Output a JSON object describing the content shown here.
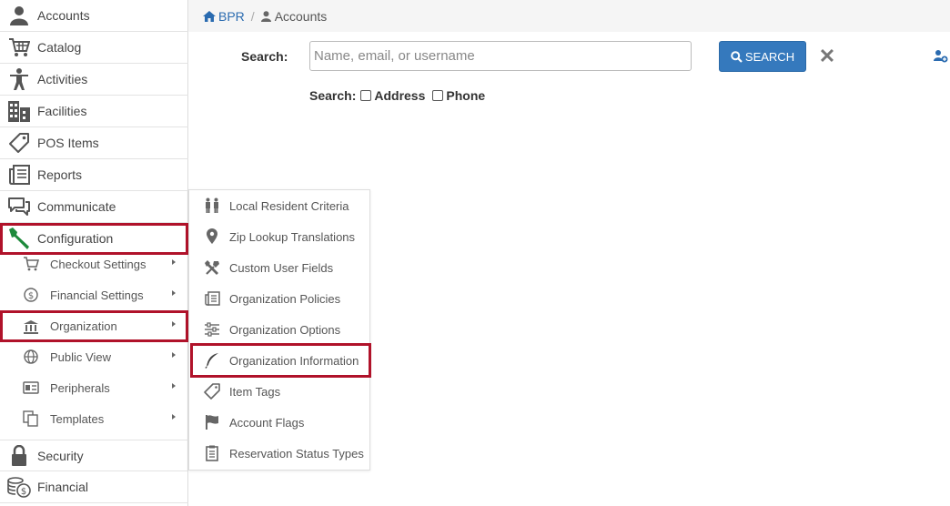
{
  "breadcrumb": {
    "home_label": "BPR",
    "separator": "/",
    "current_label": "Accounts"
  },
  "search": {
    "label": "Search:",
    "placeholder": "Name, email, or username",
    "value": "",
    "button_label": "SEARCH",
    "clear_icon": "close-icon",
    "add_icon": "add-user-icon",
    "options_label": "Search:",
    "options": [
      {
        "label": "Address",
        "checked": false
      },
      {
        "label": "Phone",
        "checked": false
      }
    ]
  },
  "sidebar": {
    "items": [
      {
        "label": "Accounts",
        "icon": "user-icon"
      },
      {
        "label": "Catalog",
        "icon": "cart-icon"
      },
      {
        "label": "Activities",
        "icon": "person-icon"
      },
      {
        "label": "Facilities",
        "icon": "building-icon"
      },
      {
        "label": "POS Items",
        "icon": "tag-icon"
      },
      {
        "label": "Reports",
        "icon": "reports-icon"
      },
      {
        "label": "Communicate",
        "icon": "chat-icon"
      },
      {
        "label": "Configuration",
        "icon": "wrench-icon"
      },
      {
        "label": "Security",
        "icon": "lock-icon"
      },
      {
        "label": "Financial",
        "icon": "money-icon"
      }
    ],
    "config_sub": [
      {
        "label": "Checkout Settings",
        "icon": "cart-icon"
      },
      {
        "label": "Financial Settings",
        "icon": "dollar-icon"
      },
      {
        "label": "Organization",
        "icon": "bank-icon"
      },
      {
        "label": "Public View",
        "icon": "globe-icon"
      },
      {
        "label": "Peripherals",
        "icon": "id-card-icon"
      },
      {
        "label": "Templates",
        "icon": "copy-icon"
      }
    ]
  },
  "flyout": {
    "items": [
      {
        "label": "Local Resident Criteria",
        "icon": "people-icon"
      },
      {
        "label": "Zip Lookup Translations",
        "icon": "map-pin-icon"
      },
      {
        "label": "Custom User Fields",
        "icon": "tools-icon"
      },
      {
        "label": "Organization Policies",
        "icon": "policies-icon"
      },
      {
        "label": "Organization Options",
        "icon": "sliders-icon"
      },
      {
        "label": "Organization Information",
        "icon": "feather-icon"
      },
      {
        "label": "Item Tags",
        "icon": "tag-icon"
      },
      {
        "label": "Account Flags",
        "icon": "flag-icon"
      },
      {
        "label": "Reservation Status Types",
        "icon": "clipboard-icon"
      }
    ]
  },
  "colors": {
    "accent": "#3579bd",
    "highlight": "#b0122a",
    "wrench": "#1e8a3c",
    "link": "#2a6bb0"
  }
}
